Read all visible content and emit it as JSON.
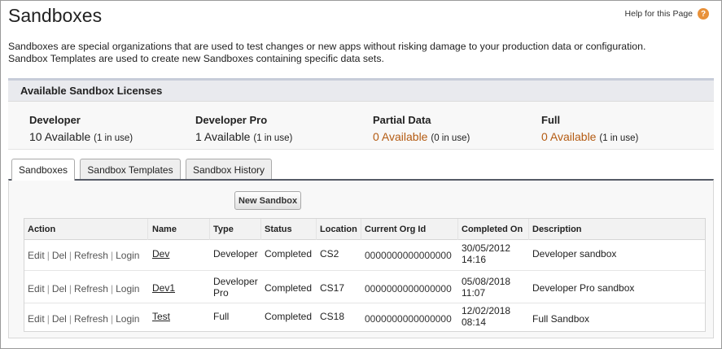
{
  "page": {
    "title": "Sandboxes",
    "help_label": "Help for this Page",
    "intro_line1": "Sandboxes are special organizations that are used to test changes or new apps without risking damage to your production data or configuration.",
    "intro_line2": "Sandbox Templates are used to create new Sandboxes containing specific data sets."
  },
  "licenses": {
    "header": "Available Sandbox Licenses",
    "items": [
      {
        "name": "Developer",
        "available": "10 Available",
        "in_use": "(1 in use)"
      },
      {
        "name": "Developer Pro",
        "available": "1 Available",
        "in_use": "(1 in use)"
      },
      {
        "name": "Partial Data",
        "available": "0 Available",
        "in_use": "(0 in use)"
      },
      {
        "name": "Full",
        "available": "0 Available",
        "in_use": "(1 in use)"
      }
    ]
  },
  "tabs": [
    {
      "label": "Sandboxes",
      "active": true
    },
    {
      "label": "Sandbox Templates",
      "active": false
    },
    {
      "label": "Sandbox History",
      "active": false
    }
  ],
  "new_sandbox_label": "New Sandbox",
  "table": {
    "columns": [
      "Action",
      "Name",
      "Type",
      "Status",
      "Location",
      "Current Org Id",
      "Completed On",
      "Description"
    ],
    "actions": [
      "Edit",
      "Del",
      "Refresh",
      "Login"
    ],
    "rows": [
      {
        "name": "Dev",
        "type_line1": "Developer",
        "type_line2": "",
        "status": "Completed",
        "location": "CS2",
        "org_id": "0000000000000000",
        "completed_date": "30/05/2012",
        "completed_time": "14:16",
        "description": "Developer sandbox"
      },
      {
        "name": "Dev1",
        "type_line1": "Developer",
        "type_line2": "Pro",
        "status": "Completed",
        "location": "CS17",
        "org_id": "0000000000000000",
        "completed_date": "05/08/2018",
        "completed_time": "11:07",
        "description": "Developer Pro sandbox"
      },
      {
        "name": "Test",
        "type_line1": "Full",
        "type_line2": "",
        "status": "Completed",
        "location": "CS18",
        "org_id": "0000000000000000",
        "completed_date": "12/02/2018",
        "completed_time": "08:14",
        "description": "Full Sandbox"
      }
    ]
  },
  "colors": {
    "accent_link": "#b45b12",
    "help_icon": "#e8913a",
    "panel_rule": "#555a66"
  },
  "icons": {
    "help": "question-circle-icon"
  }
}
